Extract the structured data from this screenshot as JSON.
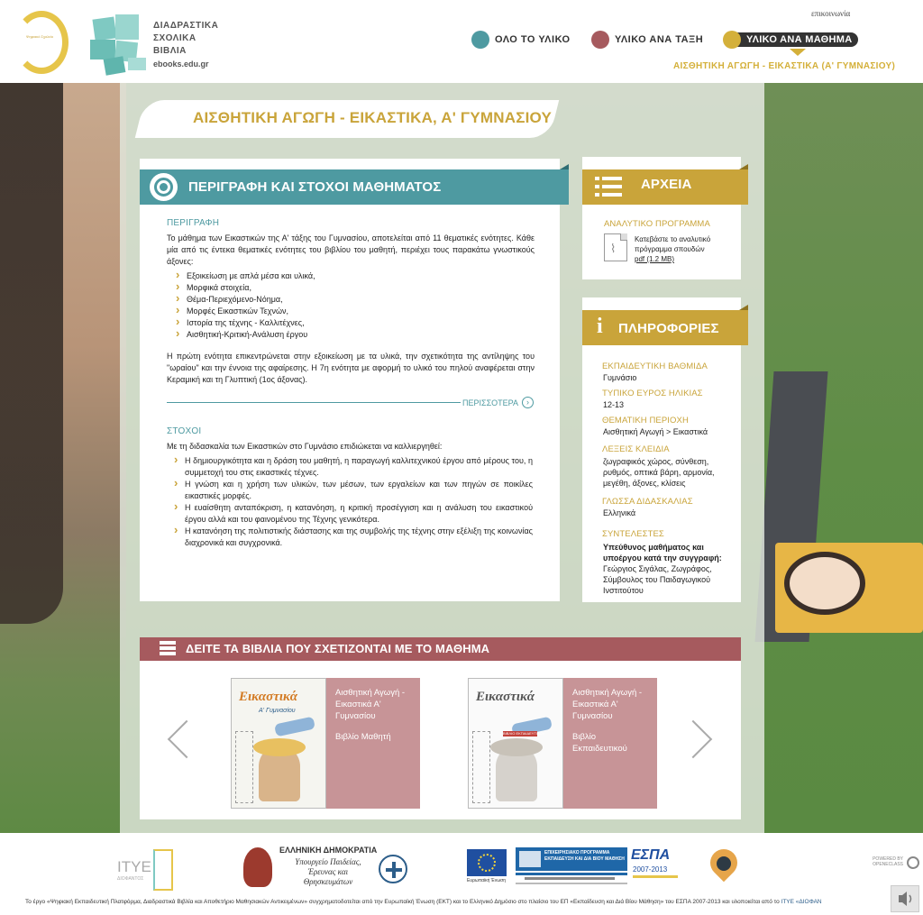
{
  "header": {
    "logo_ring_text": "Ψηφιακό Σχολείο",
    "logo_title_lines": [
      "ΔΙΑΔΡΑΣΤΙΚΑ",
      "ΣΧΟΛΙΚΑ",
      "ΒΙΒΛΙΑ"
    ],
    "logo_url": "ebooks.edu.gr",
    "contact": "επικοινωνία",
    "nav": [
      {
        "label": "ΟΛΟ ΤΟ ΥΛΙΚΟ",
        "color": "#4e9aa1"
      },
      {
        "label": "ΥΛΙΚΟ ΑΝΑ ΤΑΞΗ",
        "color": "#a65a5e"
      },
      {
        "label": "ΥΛΙΚΟ ΑΝΑ ΜΑΘΗΜΑ",
        "color": "#d4b03a"
      }
    ],
    "sub_crumb": "ΑΙΣΘΗΤΙΚΗ ΑΓΩΓΗ - ΕΙΚΑΣΤΙΚΑ (Α' ΓΥΜΝΑΣΙΟΥ)"
  },
  "page_title": "ΑΙΣΘΗΤΙΚΗ ΑΓΩΓΗ - ΕΙΚΑΣΤΙΚΑ, Α' ΓΥΜΝΑΣΙΟΥ",
  "description": {
    "header": "ΠΕΡΙΓΡΑΦΗ ΚΑΙ ΣΤΟΧΟΙ ΜΑΘΗΜΑΤΟΣ",
    "desc_label": "ΠΕΡΙΓΡΑΦΗ",
    "desc_intro": "Το μάθημα των Εικαστικών της Α' τάξης του Γυμνασίου, αποτελείται από 11 θεματικές ενότητες. Κάθε μία από τις έντεκα θεματικές ενότητες του βιβλίου του μαθητή, περιέχει τους παρακάτω γνωστικούς άξονες:",
    "axes": [
      "Εξοικείωση με απλά μέσα και υλικά,",
      "Μορφικά στοιχεία,",
      "Θέμα-Περιεχόμενο-Νόημα,",
      "Μορφές Εικαστικών Τεχνών,",
      "Ιστορία της τέχνης - Καλλιτέχνες,",
      "Αισθητική-Κριτική-Ανάλυση έργου"
    ],
    "desc_outro": "Η πρώτη ενότητα επικεντρώνεται στην εξοικείωση με τα υλικά, την σχετικότητα της αντίληψης του \"ωραίου\" και την έννοια της αφαίρεσης. Η 7η ενότητα με αφορμή το υλικό του πηλού αναφέρεται στην Κεραμική και τη Γλυπτική (1ος άξονας).",
    "more_label": "ΠΕΡΙΣΣΟΤΕΡΑ",
    "goals_label": "ΣΤΟΧΟΙ",
    "goals_intro": "Με τη διδασκαλία των Εικαστικών στο Γυμνάσιο επιδιώκεται να καλλιεργηθεί:",
    "goals": [
      "Η δημιουργικότητα και η δράση του μαθητή, η παραγωγή καλλιτεχνικού έργου από μέρους του, η συμμετοχή του στις εικαστικές τέχνες.",
      "Η γνώση και η χρήση των υλικών, των μέσων, των εργαλείων και των πηγών σε ποικίλες εικαστικές μορφές.",
      "Η ευαίσθητη ανταπόκριση, η κατανόηση, η κριτική προσέγγιση και η ανάλυση του εικαστικού έργου αλλά και του φαινομένου της Τέχνης γενικότερα.",
      "Η κατανόηση της πολιτιστικής διάστασης και της συμβολής της τέχνης στην εξέλιξη της κοινωνίας διαχρονικά και συγχρονικά."
    ]
  },
  "files": {
    "header": "ΑΡΧΕΙΑ",
    "label": "ΑΝΑΛΥΤΙΚΟ ΠΡΟΓΡΑΜΜΑ",
    "text_line1": "Κατεβάστε το αναλυτικό",
    "text_line2": "πρόγραμμα σπουδών",
    "pdf_link": "pdf (1.2 MB)"
  },
  "info": {
    "header": "ΠΛΗΡΟΦΟΡΙΕΣ",
    "level_label": "ΕΚΠΑΙΔΕΥΤΙΚΗ ΒΑΘΜΙΔΑ",
    "level_value": "Γυμνάσιο",
    "age_label": "ΤΥΠΙΚΟ ΕΥΡΟΣ ΗΛΙΚΙΑΣ",
    "age_value": "12-13",
    "area_label": "ΘΕΜΑΤΙΚΗ ΠΕΡΙΟΧΗ",
    "area_value": "Αισθητική Αγωγή > Εικαστικά",
    "keywords_label": "ΛΕΞΕΙΣ ΚΛΕΙΔΙΑ",
    "keywords_value": "ζωγραφικός χώρος, σύνθεση, ρυθμός, οπτικά βάρη, αρμονία, μεγέθη, άξονες, κλίσεις",
    "language_label": "ΓΛΩΣΣΑ ΔΙΔΑΣΚΑΛΙΑΣ",
    "language_value": "Ελληνικά",
    "contributors_label": "ΣΥΝΤΕΛΕΣΤΕΣ",
    "contributors_role": "Υπεύθυνος μαθήματος και υποέργου κατά την συγγραφή:",
    "contributors_name": "Γεώργιος Σιγάλας, Ζωγράφος, Σύμβουλος του Παιδαγωγικού Ινστιτούτου"
  },
  "related": {
    "header": "ΔΕΙΤΕ ΤΑ ΒΙΒΛΙΑ ΠΟΥ ΣΧΕΤΙΖΟΝΤΑΙ ΜΕ ΤΟ ΜΑΘΗΜΑ",
    "books": [
      {
        "cover_title": "Εικαστικά",
        "cover_sub": "Α' Γυμνασίου",
        "title": "Αισθητική Αγωγή - Εικαστικά Α' Γυμνασίου",
        "kind": "Βιβλίο Μαθητή"
      },
      {
        "cover_title": "Εικαστικά",
        "cover_sub": "ΒΙΒΛΙΟ ΕΚΠΑΙΔΕΥΤΙΚΟΥ",
        "title": "Αισθητική Αγωγή - Εικαστικά Α' Γυμνασίου",
        "kind": "Βιβλίο Εκπαιδευτικού"
      }
    ]
  },
  "footer": {
    "itye": "ΙΤΥΕ",
    "itye_sub": "ΔΙΟΦΑΝΤΟΣ",
    "greek_republic": "ΕΛΛΗΝΙΚΗ ΔΗΜΟΚΡΑΤΙΑ",
    "ministry": "Υπουργείο Παιδείας, Έρευνας και Θρησκευμάτων",
    "eu_label": "Ευρωπαϊκή Ένωση",
    "op_label": "ΕΠΙΧΕΙΡΗΣΙΑΚΟ ΠΡΟΓΡΑΜΜΑ ΕΚΠΑΙΔΕΥΣΗ ΚΑΙ ΔΙΑ ΒΙΟΥ ΜΑΘΗΣΗ",
    "espa": "ΕΣΠΑ",
    "espa_years": "2007-2013",
    "powered_by": "POWERED BY OPENECLASS",
    "credits_main": "Το έργο «Ψηφιακή Εκπαιδευτική Πλατφόρμα, Διαδραστικά Βιβλία και Αποθετήριο Μαθησιακών Αντικειμένων» συγχρηματοδοτείται από την Ευρωπαϊκή Ένωση (ΕΚΤ) και το Ελληνικό Δημόσιο στο πλαίσιο του ΕΠ «Εκπαίδευση και Διά Βίου Μάθηση» του ΕΣΠΑ 2007-2013 και υλοποιείται από το ",
    "credits_link": "ΙΤΥΕ «ΔΙΟΦΑΝ"
  }
}
